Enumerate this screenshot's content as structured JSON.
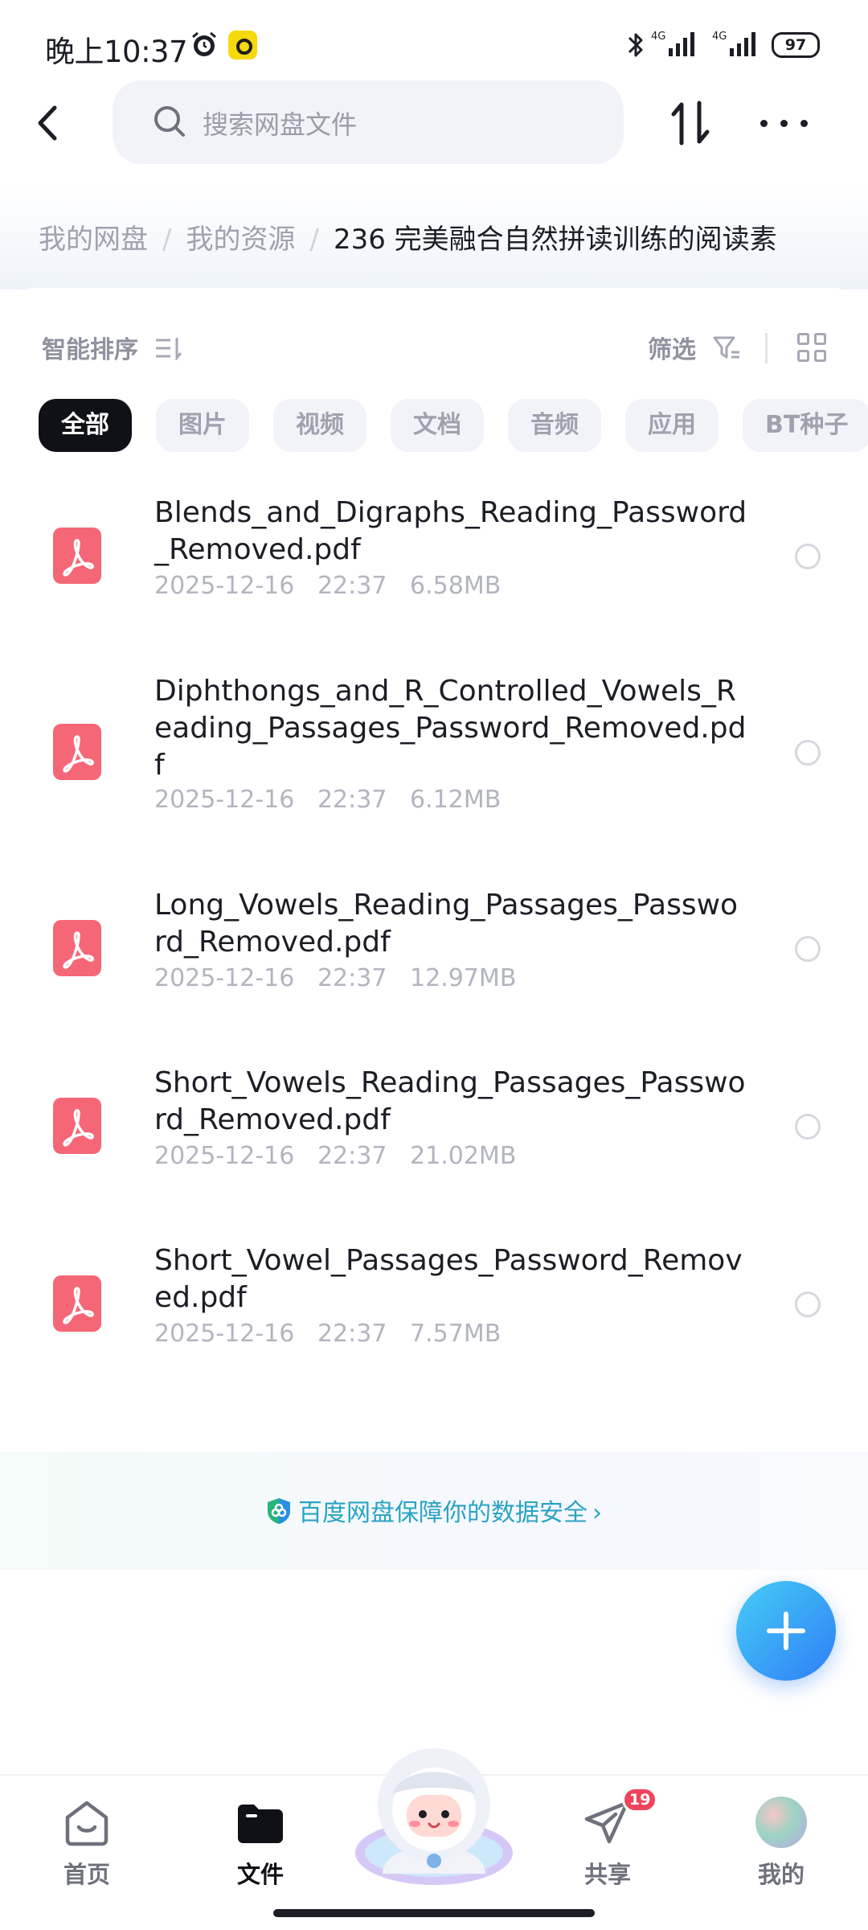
{
  "status_bar": {
    "time": "晚上10:37",
    "network_1": "4G",
    "network_2": "4G",
    "battery": "97"
  },
  "header": {
    "search_placeholder": "搜索网盘文件"
  },
  "breadcrumb": {
    "items": [
      "我的网盘",
      "我的资源"
    ],
    "separator": "/",
    "current": "236  完美融合自然拼读训练的阅读素"
  },
  "toolbar": {
    "sort_label": "智能排序",
    "filter_label": "筛选"
  },
  "categories": [
    "全部",
    "图片",
    "视频",
    "文档",
    "音频",
    "应用",
    "BT种子"
  ],
  "files": [
    {
      "name": "Blends_and_Digraphs_Reading_Password_Removed.pdf",
      "date": "2025-12-16",
      "time": "22:37",
      "size": "6.58MB"
    },
    {
      "name": "Diphthongs_and_R_Controlled_Vowels_Reading_Passages_Password_Removed.pdf",
      "date": "2025-12-16",
      "time": "22:37",
      "size": "6.12MB"
    },
    {
      "name": "Long_Vowels_Reading_Passages_Password_Removed.pdf",
      "date": "2025-12-16",
      "time": "22:37",
      "size": "12.97MB"
    },
    {
      "name": "Short_Vowels_Reading_Passages_Password_Removed.pdf",
      "date": "2025-12-16",
      "time": "22:37",
      "size": "21.02MB"
    },
    {
      "name": "Short_Vowel_Passages_Password_Removed.pdf",
      "date": "2025-12-16",
      "time": "22:37",
      "size": "7.57MB"
    }
  ],
  "security_banner": {
    "text": "百度网盘保障你的数据安全",
    "chevron": "›"
  },
  "bottom_nav": {
    "items": [
      {
        "label": "首页",
        "icon": "home-icon"
      },
      {
        "label": "文件",
        "icon": "folder-icon"
      },
      {
        "label": "共享",
        "icon": "share-icon",
        "badge": "19"
      },
      {
        "label": "我的",
        "icon": "avatar"
      }
    ]
  },
  "colors": {
    "accent": "#2e7ef5",
    "pdf_icon": "#f56777",
    "badge": "#f0445b",
    "security_text": "#2aa3c4"
  }
}
